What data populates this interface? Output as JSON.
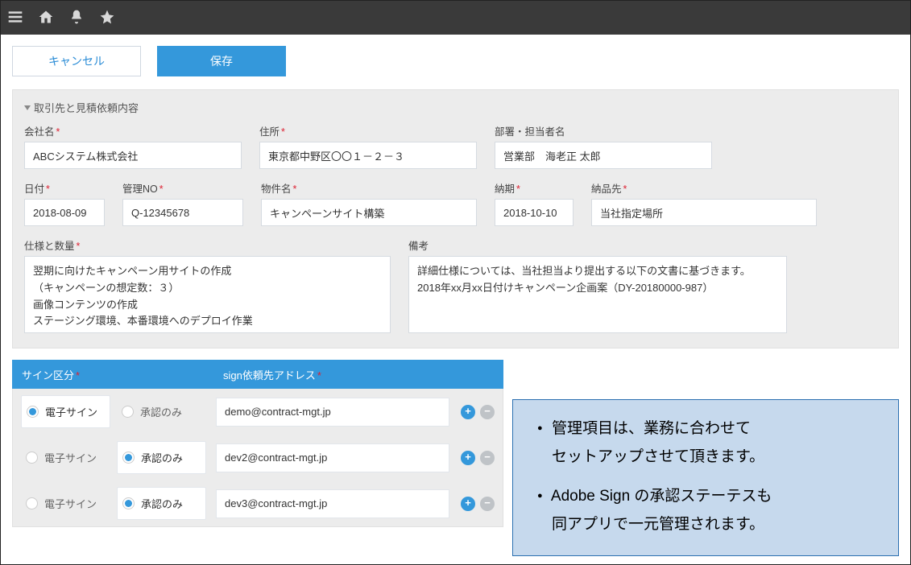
{
  "topbar": {
    "menu_icon": "menu-icon",
    "home_icon": "home-icon",
    "bell_icon": "bell-icon",
    "star_icon": "star-icon"
  },
  "buttons": {
    "cancel": "キャンセル",
    "save": "保存"
  },
  "section": {
    "title": "取引先と見積依頼内容"
  },
  "fields": {
    "company": {
      "label": "会社名",
      "required": true,
      "value": "ABCシステム株式会社"
    },
    "address": {
      "label": "住所",
      "required": true,
      "value": "東京都中野区〇〇１－２－３"
    },
    "contact": {
      "label": "部署・担当者名",
      "required": false,
      "value": "営業部　海老正 太郎"
    },
    "date": {
      "label": "日付",
      "required": true,
      "value": "2018-08-09"
    },
    "mgmt_no": {
      "label": "管理NO",
      "required": true,
      "value": "Q-12345678"
    },
    "subject": {
      "label": "物件名",
      "required": true,
      "value": "キャンペーンサイト構築"
    },
    "due": {
      "label": "納期",
      "required": true,
      "value": "2018-10-10"
    },
    "ship_to": {
      "label": "納品先",
      "required": true,
      "value": "当社指定場所"
    },
    "spec": {
      "label": "仕様と数量",
      "required": true,
      "value": "翌期に向けたキャンペーン用サイトの作成\n（キャンペーンの想定数：３）\n画像コンテンツの作成\nステージング環境、本番環境へのデプロイ作業"
    },
    "notes": {
      "label": "備考",
      "required": false,
      "value": "詳細仕様については、当社担当より提出する以下の文書に基づきます。\n2018年xx月xx日付けキャンペーン企画案（DY-20180000-987）"
    }
  },
  "sign_table": {
    "headers": {
      "type": "サイン区分",
      "address": "sign依頼先アドレス"
    },
    "type_options": {
      "esign": "電子サイン",
      "approve": "承認のみ"
    },
    "rows": [
      {
        "selected": "esign",
        "address": "demo@contract-mgt.jp"
      },
      {
        "selected": "approve",
        "address": "dev2@contract-mgt.jp"
      },
      {
        "selected": "approve",
        "address": "dev3@contract-mgt.jp"
      }
    ]
  },
  "callout": {
    "line1a": "管理項目は、業務に合わせて",
    "line1b": "セットアップさせて頂きます。",
    "line2a": "Adobe Sign の承認ステーテスも",
    "line2b": "同アプリで一元管理されます。"
  }
}
